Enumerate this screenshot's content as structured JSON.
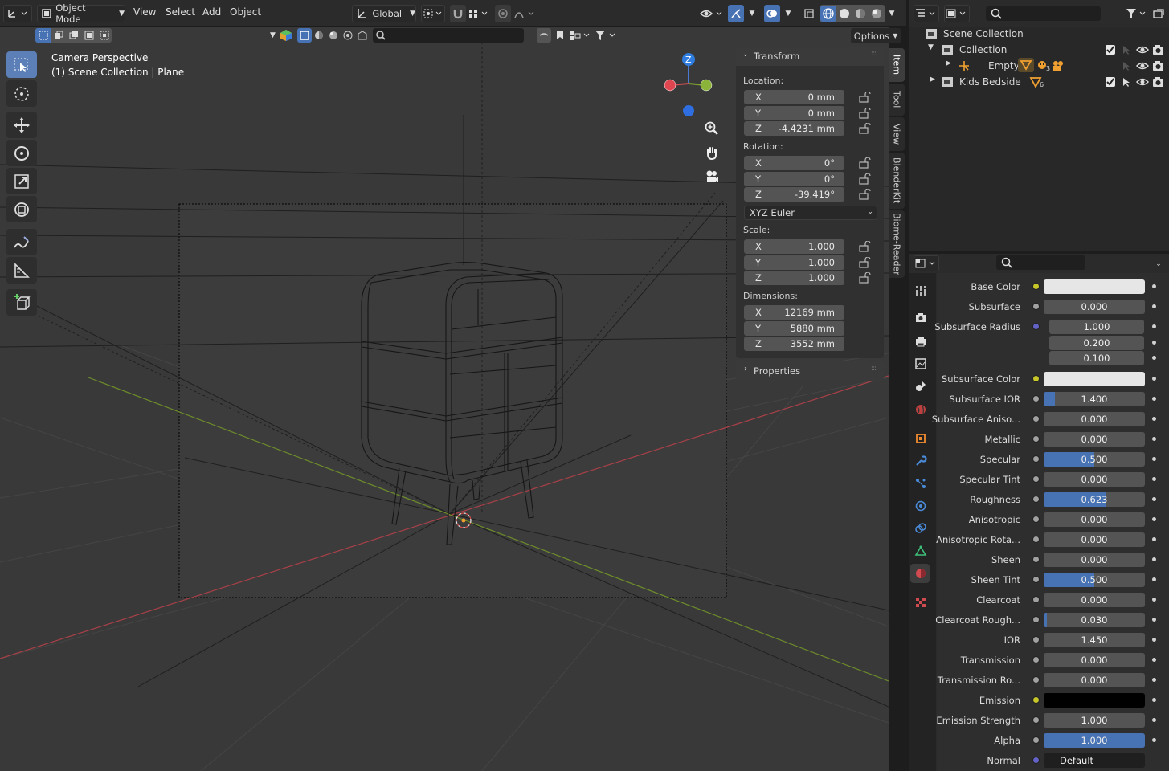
{
  "header": {
    "mode_label": "Object Mode",
    "menus": [
      "View",
      "Select",
      "Add",
      "Object"
    ],
    "orientation_label": "Global",
    "options_label": "Options"
  },
  "viewport": {
    "view_name": "Camera Perspective",
    "context": "(1) Scene Collection | Plane",
    "gizmo_axes": {
      "z": "Z"
    }
  },
  "npanel": {
    "title": "Transform",
    "location_label": "Location:",
    "location": [
      {
        "axis": "X",
        "value": "0 mm"
      },
      {
        "axis": "Y",
        "value": "0 mm"
      },
      {
        "axis": "Z",
        "value": "-4.4231 mm"
      }
    ],
    "rotation_label": "Rotation:",
    "rotation": [
      {
        "axis": "X",
        "value": "0°"
      },
      {
        "axis": "Y",
        "value": "0°"
      },
      {
        "axis": "Z",
        "value": "-39.419°"
      }
    ],
    "rotation_mode": "XYZ Euler",
    "scale_label": "Scale:",
    "scale": [
      {
        "axis": "X",
        "value": "1.000"
      },
      {
        "axis": "Y",
        "value": "1.000"
      },
      {
        "axis": "Z",
        "value": "1.000"
      }
    ],
    "dimensions_label": "Dimensions:",
    "dimensions": [
      {
        "axis": "X",
        "value": "12169 mm"
      },
      {
        "axis": "Y",
        "value": "5880 mm"
      },
      {
        "axis": "Z",
        "value": "3552 mm"
      }
    ],
    "properties_label": "Properties",
    "tabs": [
      "Item",
      "Tool",
      "View",
      "BlenderKit",
      "Biome-Reader"
    ]
  },
  "outliner": {
    "rows": [
      {
        "label": "Scene Collection"
      },
      {
        "label": "Collection"
      },
      {
        "label": "Empty",
        "badge1": "3"
      },
      {
        "label": "Kids Bedside",
        "badge1": "6"
      }
    ]
  },
  "properties": {
    "rows": [
      {
        "label": "Base Color",
        "socket": "#c7c729",
        "kind": "color",
        "color": "#e6e6e6"
      },
      {
        "label": "Subsurface",
        "socket": "#a1a1a1",
        "kind": "num",
        "value": "0.000",
        "fill": 0
      },
      {
        "label": "Subsurface Radius",
        "socket": "#6363c7",
        "kind": "vec",
        "values": [
          "1.000",
          "0.200",
          "0.100"
        ]
      },
      {
        "label": "Subsurface Color",
        "socket": "#c7c729",
        "kind": "color",
        "color": "#e6e6e6"
      },
      {
        "label": "Subsurface IOR",
        "socket": "#a1a1a1",
        "kind": "num",
        "value": "1.400",
        "fill": 0.11
      },
      {
        "label": "Subsurface Aniso...",
        "socket": "#a1a1a1",
        "kind": "num",
        "value": "0.000",
        "fill": 0
      },
      {
        "label": "Metallic",
        "socket": "#a1a1a1",
        "kind": "num",
        "value": "0.000",
        "fill": 0
      },
      {
        "label": "Specular",
        "socket": "#a1a1a1",
        "kind": "num",
        "value": "0.500",
        "fill": 0.5
      },
      {
        "label": "Specular Tint",
        "socket": "#a1a1a1",
        "kind": "num",
        "value": "0.000",
        "fill": 0
      },
      {
        "label": "Roughness",
        "socket": "#a1a1a1",
        "kind": "num",
        "value": "0.623",
        "fill": 0.623
      },
      {
        "label": "Anisotropic",
        "socket": "#a1a1a1",
        "kind": "num",
        "value": "0.000",
        "fill": 0
      },
      {
        "label": "Anisotropic Rota...",
        "socket": "#a1a1a1",
        "kind": "num",
        "value": "0.000",
        "fill": 0
      },
      {
        "label": "Sheen",
        "socket": "#a1a1a1",
        "kind": "num",
        "value": "0.000",
        "fill": 0
      },
      {
        "label": "Sheen Tint",
        "socket": "#a1a1a1",
        "kind": "num",
        "value": "0.500",
        "fill": 0.5
      },
      {
        "label": "Clearcoat",
        "socket": "#a1a1a1",
        "kind": "num",
        "value": "0.000",
        "fill": 0
      },
      {
        "label": "Clearcoat Rough...",
        "socket": "#a1a1a1",
        "kind": "num",
        "value": "0.030",
        "fill": 0.03
      },
      {
        "label": "IOR",
        "socket": "#a1a1a1",
        "kind": "num",
        "value": "1.450",
        "fill": 0
      },
      {
        "label": "Transmission",
        "socket": "#a1a1a1",
        "kind": "num",
        "value": "0.000",
        "fill": 0
      },
      {
        "label": "Transmission Ro...",
        "socket": "#a1a1a1",
        "kind": "num",
        "value": "0.000",
        "fill": 0
      },
      {
        "label": "Emission",
        "socket": "#c7c729",
        "kind": "color",
        "color": "#000000"
      },
      {
        "label": "Emission Strength",
        "socket": "#a1a1a1",
        "kind": "num",
        "value": "1.000",
        "fill": 0
      },
      {
        "label": "Alpha",
        "socket": "#a1a1a1",
        "kind": "num",
        "value": "1.000",
        "fill": 1
      },
      {
        "label": "Normal",
        "socket": "#6363c7",
        "kind": "text",
        "value": "Default"
      }
    ]
  },
  "colors": {
    "accent": "#4772b3",
    "x_axis": "#d4454f",
    "y_axis": "#6d9b2a"
  }
}
